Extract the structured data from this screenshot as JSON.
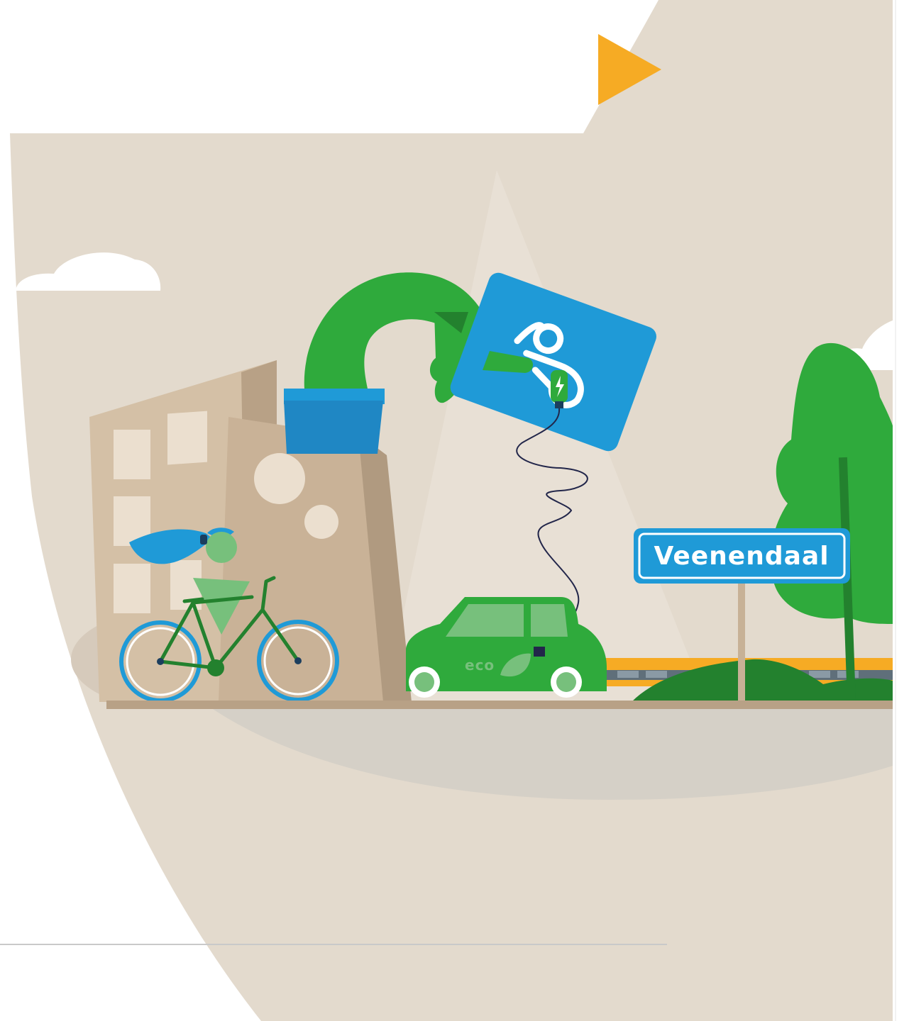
{
  "illustration": {
    "sign_text": "Veenendaal",
    "car_label": "eco",
    "icons": {
      "play": "play-triangle-icon",
      "charge_card_logo": "charging-card-logo-icon",
      "lightning": "lightning-bolt-icon",
      "eco_leaf": "leaf-icon"
    }
  },
  "colors": {
    "background": "#ffffff",
    "beige": "#e3dacd",
    "ground_oval": "#d5d0c7",
    "building_light": "#c7b196",
    "building_dark": "#b39d84",
    "green": "#2faa3c",
    "dark_green": "#23812e",
    "light_green": "#77c07c",
    "blue": "#1f9ad7",
    "dark_blue": "#1b4f8c",
    "orange": "#f6ab24",
    "cloud": "#ffffff"
  }
}
